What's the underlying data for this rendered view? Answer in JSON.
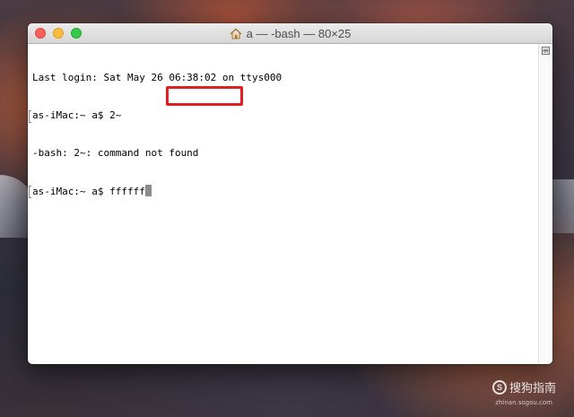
{
  "window": {
    "title": "a — -bash — 80×25",
    "title_icon": "home-icon"
  },
  "terminal": {
    "lines": [
      "Last login: Sat May 26 06:38:02 on ttys000",
      "as-iMac:~ a$ 2~",
      "-bash: 2~: command not found",
      "as-iMac:~ a$ ffffff"
    ]
  },
  "watermark": {
    "text": "搜狗指南",
    "sub": "zhinan.sogou.com"
  },
  "colors": {
    "close": "#fc605b",
    "minimize": "#fdbc40",
    "zoom": "#34c84a",
    "highlight_box": "#e02020",
    "cursor": "#8c8c8c"
  }
}
